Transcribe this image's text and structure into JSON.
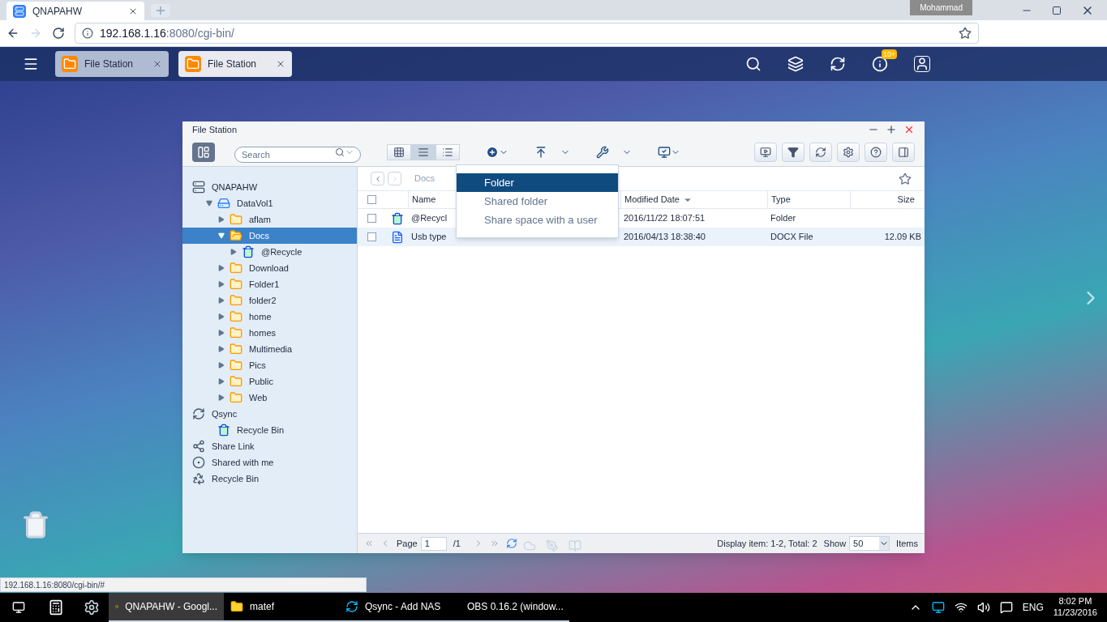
{
  "browser": {
    "tab_title": "QNAPAHW",
    "profile": "Mohammad",
    "url_host": "192.168.1.16",
    "url_path": ":8080/cgi-bin/"
  },
  "topbar": {
    "app_tabs": [
      {
        "label": "File Station",
        "selected": false
      },
      {
        "label": "File Station",
        "selected": true
      }
    ],
    "notification_badge": "10+"
  },
  "window": {
    "title": "File Station",
    "search": {
      "placeholder": "Search"
    },
    "view_modes": [
      {
        "kind": "thumbnails",
        "selected": false
      },
      {
        "kind": "list",
        "selected": true
      },
      {
        "kind": "details",
        "selected": false
      }
    ]
  },
  "tree": [
    {
      "label": "QNAPAHW",
      "kind": "nas",
      "selected": false,
      "children": [
        {
          "label": "DataVol1",
          "kind": "volume",
          "expanded": true,
          "selected": false,
          "children": [
            {
              "label": "aflam",
              "kind": "folder",
              "expanded": false,
              "selected": false
            },
            {
              "label": "Docs",
              "kind": "folder",
              "expanded": true,
              "selected": true,
              "children": [
                {
                  "label": "@Recycle",
                  "kind": "recycle",
                  "expanded": false,
                  "selected": false
                }
              ]
            },
            {
              "label": "Download",
              "kind": "folder",
              "expanded": false,
              "selected": false
            },
            {
              "label": "Folder1",
              "kind": "folder",
              "expanded": false,
              "selected": false
            },
            {
              "label": "folder2",
              "kind": "folder",
              "expanded": false,
              "selected": false
            },
            {
              "label": "home",
              "kind": "folder",
              "expanded": false,
              "selected": false
            },
            {
              "label": "homes",
              "kind": "folder",
              "expanded": false,
              "selected": false
            },
            {
              "label": "Multimedia",
              "kind": "folder",
              "expanded": false,
              "selected": false
            },
            {
              "label": "Pics",
              "kind": "folder",
              "expanded": false,
              "selected": false
            },
            {
              "label": "Public",
              "kind": "folder",
              "expanded": false,
              "selected": false
            },
            {
              "label": "Web",
              "kind": "folder",
              "expanded": false,
              "selected": false
            }
          ]
        }
      ]
    },
    {
      "label": "Qsync",
      "kind": "qsync",
      "selected": false,
      "children": [
        {
          "label": "Recycle Bin",
          "kind": "recycle",
          "selected": false
        }
      ]
    },
    {
      "label": "Share Link",
      "kind": "share",
      "selected": false
    },
    {
      "label": "Shared with me",
      "kind": "shared",
      "selected": false
    },
    {
      "label": "Recycle Bin",
      "kind": "bin",
      "selected": false
    }
  ],
  "breadcrumb": "Docs",
  "menu": [
    {
      "label": "Folder",
      "selected": true
    },
    {
      "label": "Shared folder",
      "selected": false
    },
    {
      "label": "Share space with a user",
      "selected": false
    }
  ],
  "table": {
    "all_checked": false,
    "columns": [
      "Name",
      "Modified Date",
      "Type",
      "Size"
    ],
    "rows": [
      {
        "kind": "recycle",
        "name": "@Recycl",
        "modified": "2016/11/22 18:07:51",
        "type": "Folder",
        "checked": false,
        "hovered": false
      },
      {
        "kind": "document",
        "name": "Usb type",
        "modified": "2016/04/13 18:38:40",
        "type": "DOCX File",
        "size": "12.09 KB",
        "checked": false,
        "hovered": true
      }
    ]
  },
  "pager": {
    "page_label": "Page",
    "page": "1",
    "total_pages": "/1",
    "display": "Display item: 1-2, Total: 2",
    "show_label": "Show",
    "per_page": "50",
    "items_label": "Items"
  },
  "status_url": "192.168.1.16:8080/cgi-bin/#",
  "taskbar": {
    "apps": [
      {
        "label": "QNAPAHW - Googl...",
        "kind": "chrome",
        "selected": true
      },
      {
        "label": "matef",
        "kind": "folder",
        "selected": false
      },
      {
        "label": "Qsync - Add NAS",
        "kind": "qsync",
        "selected": false
      },
      {
        "label": "OBS 0.16.2 (window...",
        "kind": "obs",
        "selected": false
      }
    ],
    "language": "ENG",
    "time": "8:02 PM",
    "date": "11/23/2016"
  }
}
